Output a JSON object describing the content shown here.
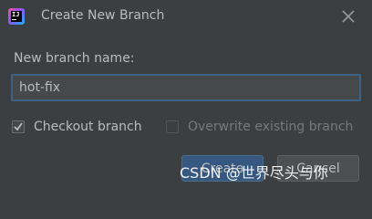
{
  "window": {
    "title": "Create New Branch",
    "app_icon": "intellij-idea-icon",
    "app_icon_text": "IJ",
    "close_icon": "close-icon"
  },
  "form": {
    "name_label": "New branch name:",
    "name_value": "hot-fix",
    "checkout": {
      "label": "Checkout branch",
      "checked": true
    },
    "overwrite": {
      "label": "Overwrite existing branch",
      "checked": false,
      "enabled": false
    }
  },
  "buttons": {
    "create_label": "Create",
    "cancel_label": "Cancel"
  },
  "watermark": "CSDN @世界尽头与你",
  "colors": {
    "background": "#3c3f41",
    "text": "#bbbbbb",
    "input_background": "#45494a",
    "focus_border": "#3d6185",
    "primary_button": "#365880",
    "secondary_button": "#4c5052"
  }
}
